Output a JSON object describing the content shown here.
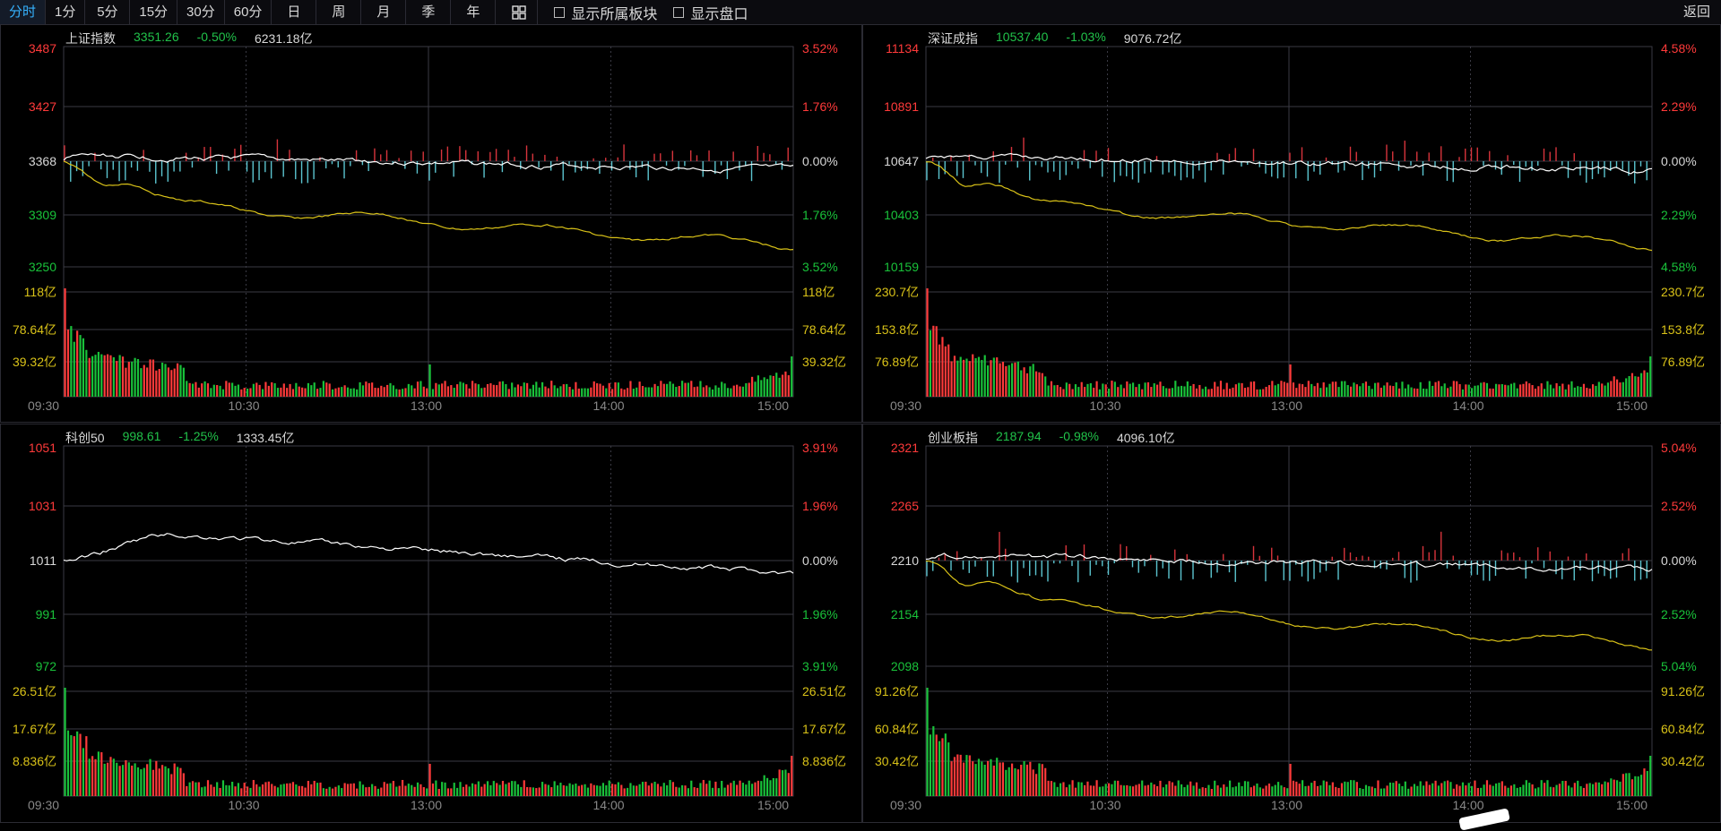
{
  "toolbar": {
    "periods": [
      "分时",
      "1分",
      "5分",
      "15分",
      "30分",
      "60分",
      "日",
      "周",
      "月",
      "季",
      "年"
    ],
    "active_index": 0,
    "grid_icon": "grid-icon",
    "check_sector": "显示所属板块",
    "check_board": "显示盘口",
    "back": "返回"
  },
  "colors": {
    "up": "#ff3a3a",
    "down": "#19c23a",
    "price_line": "#ffffff",
    "avg_line": "#d9c218",
    "diff_up": "#d7343c",
    "diff_down": "#5bc4cf",
    "grid": "#3a3a44"
  },
  "panels": [
    {
      "name": "上证指数",
      "price": "3351.26",
      "pct": "-0.50%",
      "amount": "6231.18亿",
      "y_left": [
        "3487",
        "3427",
        "3368",
        "3309",
        "3250"
      ],
      "y_right": [
        "3.52%",
        "1.76%",
        "0.00%",
        "1.76%",
        "3.52%"
      ],
      "vol_left": [
        "118亿",
        "78.64亿",
        "39.32亿"
      ],
      "vol_right": [
        "118亿",
        "78.64亿",
        "39.32亿"
      ],
      "x_labels": [
        "09:30",
        "10:30",
        "13:00",
        "14:00",
        "15:00"
      ],
      "has_avg_line": true,
      "has_diff_bars": true
    },
    {
      "name": "深证成指",
      "price": "10537.40",
      "pct": "-1.03%",
      "amount": "9076.72亿",
      "y_left": [
        "11134",
        "10891",
        "10647",
        "10403",
        "10159"
      ],
      "y_right": [
        "4.58%",
        "2.29%",
        "0.00%",
        "2.29%",
        "4.58%"
      ],
      "vol_left": [
        "230.7亿",
        "153.8亿",
        "76.89亿"
      ],
      "vol_right": [
        "230.7亿",
        "153.8亿",
        "76.89亿"
      ],
      "x_labels": [
        "09:30",
        "10:30",
        "13:00",
        "14:00",
        "15:00"
      ],
      "has_avg_line": true,
      "has_diff_bars": true
    },
    {
      "name": "科创50",
      "price": "998.61",
      "pct": "-1.25%",
      "amount": "1333.45亿",
      "y_left": [
        "1051",
        "1031",
        "1011",
        "991",
        "972"
      ],
      "y_right": [
        "3.91%",
        "1.96%",
        "0.00%",
        "1.96%",
        "3.91%"
      ],
      "vol_left": [
        "26.51亿",
        "17.67亿",
        "8.836亿"
      ],
      "vol_right": [
        "26.51亿",
        "17.67亿",
        "8.836亿"
      ],
      "x_labels": [
        "09:30",
        "10:30",
        "13:00",
        "14:00",
        "15:00"
      ],
      "has_avg_line": false,
      "has_diff_bars": false
    },
    {
      "name": "创业板指",
      "price": "2187.94",
      "pct": "-0.98%",
      "amount": "4096.10亿",
      "y_left": [
        "2321",
        "2265",
        "2210",
        "2154",
        "2098"
      ],
      "y_right": [
        "5.04%",
        "2.52%",
        "0.00%",
        "2.52%",
        "5.04%"
      ],
      "vol_left": [
        "91.26亿",
        "60.84亿",
        "30.42亿"
      ],
      "vol_right": [
        "91.26亿",
        "60.84亿",
        "30.42亿"
      ],
      "x_labels": [
        "09:30",
        "10:30",
        "13:00",
        "14:00",
        "15:00"
      ],
      "has_avg_line": true,
      "has_diff_bars": true
    }
  ]
}
